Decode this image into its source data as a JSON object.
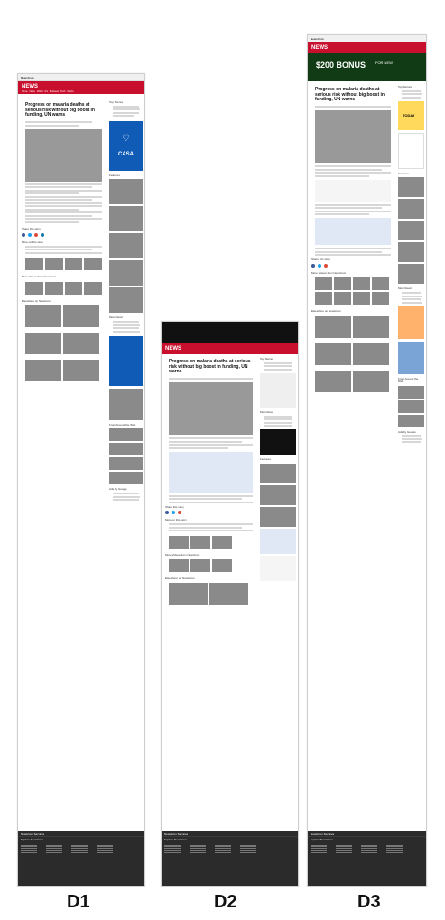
{
  "labels": [
    "D1",
    "D2",
    "D3"
  ],
  "page": {
    "headline": "Progress on malaria deaths at serious risk without big boost in funding, UN warns",
    "top_stories": "Top Stories",
    "more_stories": "More on this story",
    "more_videos": "More Videos from NewsCom",
    "elsewhere": "Elsewhere on NewsCom",
    "most_read": "Most Read",
    "features": "Features",
    "from_around": "From Around the Web",
    "ads_by_google": "Ads by Google",
    "explore": "Explore NewsCom",
    "services": "NewsCom Services",
    "share": "Share this story",
    "casa": "CASA",
    "bonus": "$200 BONUS",
    "bonus_sub": "FOR NEW",
    "today": "TODAY",
    "news": "NEWS",
    "newscom": "NewsCom"
  }
}
